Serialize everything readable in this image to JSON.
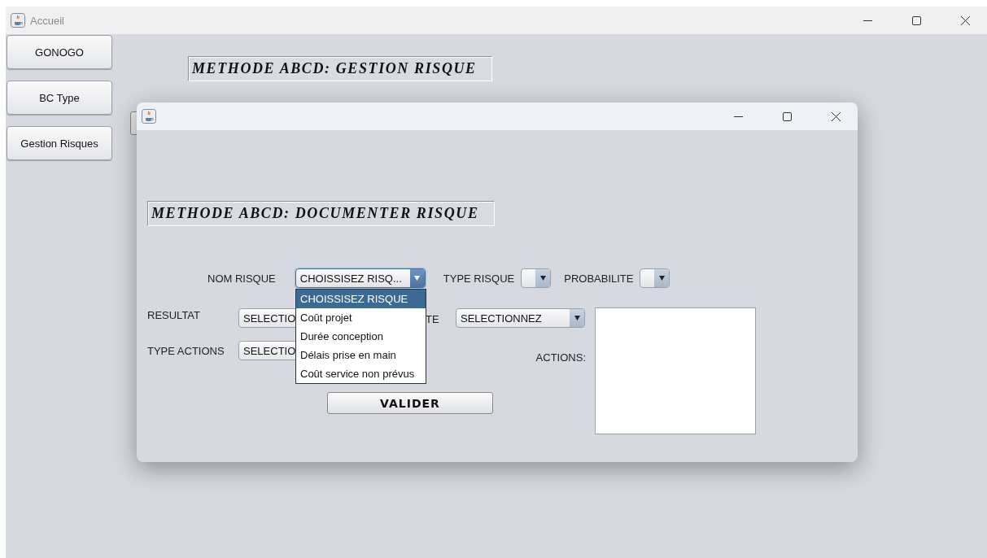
{
  "main_window": {
    "title": "Accueil",
    "nav_buttons": [
      "GONOGO",
      "BC Type",
      "Gestion Risques"
    ],
    "heading": "METHODE ABCD: GESTION RISQUE"
  },
  "dialog": {
    "heading": "METHODE ABCD: DOCUMENTER RISQUE",
    "top_fields": [
      {
        "label": "NOM RISQUE",
        "value": "CHOISSISEZ RISQ...",
        "open": true
      },
      {
        "label": "TYPE RISQUE",
        "open": false
      },
      {
        "label": "PROBABILITE",
        "open": false
      }
    ],
    "options": [
      {
        "label": "CHOISSISEZ RISQUE",
        "selected": true
      },
      {
        "label": "Coût projet",
        "selected": false
      },
      {
        "label": "Durée conception",
        "selected": false
      },
      {
        "label": "Délais prise en main",
        "selected": false
      },
      {
        "label": "Coût service non prévus",
        "selected": false
      }
    ],
    "resultat": {
      "label": "RESULTAT",
      "value": "SELECTIO"
    },
    "type_actions": {
      "label": "TYPE ACTIONS",
      "value": "SELECTIO"
    },
    "partial_label": "TE",
    "criticity_value": "SELECTIONNEZ",
    "actions_label": "ACTIONS:",
    "submit": "VALIDER"
  }
}
